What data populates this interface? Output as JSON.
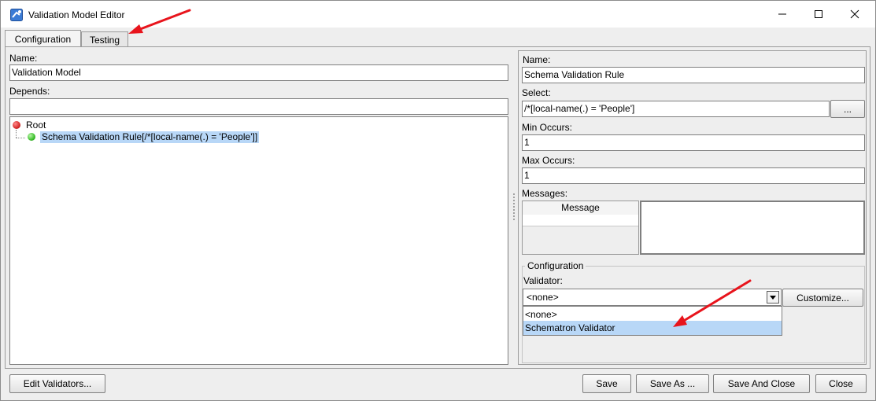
{
  "window": {
    "title": "Validation Model Editor"
  },
  "tabs": [
    {
      "label": "Configuration",
      "active": true
    },
    {
      "label": "Testing",
      "active": false
    }
  ],
  "left": {
    "name_label": "Name:",
    "name_value": "Validation Model",
    "depends_label": "Depends:",
    "depends_value": "",
    "tree": {
      "root_label": "Root",
      "root_status_color": "#d62a2a",
      "child_label": "Schema Validation Rule[/*[local-name(.) = 'People']]",
      "child_status_color": "#3cbf2c"
    }
  },
  "right": {
    "name_label": "Name:",
    "name_value": "Schema Validation Rule",
    "select_label": "Select:",
    "select_value": "/*[local-name(.) = 'People']",
    "select_browse_label": "...",
    "min_occurs_label": "Min Occurs:",
    "min_occurs_value": "1",
    "max_occurs_label": "Max Occurs:",
    "max_occurs_value": "1",
    "messages_label": "Messages:",
    "messages_column": "Message",
    "configuration": {
      "group_title": "Configuration",
      "validator_label": "Validator:",
      "validator_value": "<none>",
      "customize_label": "Customize...",
      "options": [
        "<none>",
        "Schematron Validator"
      ],
      "highlighted_option": "Schematron Validator"
    }
  },
  "footer": {
    "edit_validators_label": "Edit Validators...",
    "save_label": "Save",
    "save_as_label": "Save As ...",
    "save_close_label": "Save And Close",
    "close_label": "Close"
  },
  "colors": {
    "annotation_arrow": "#e8141c",
    "selection": "#b8d7f7"
  }
}
